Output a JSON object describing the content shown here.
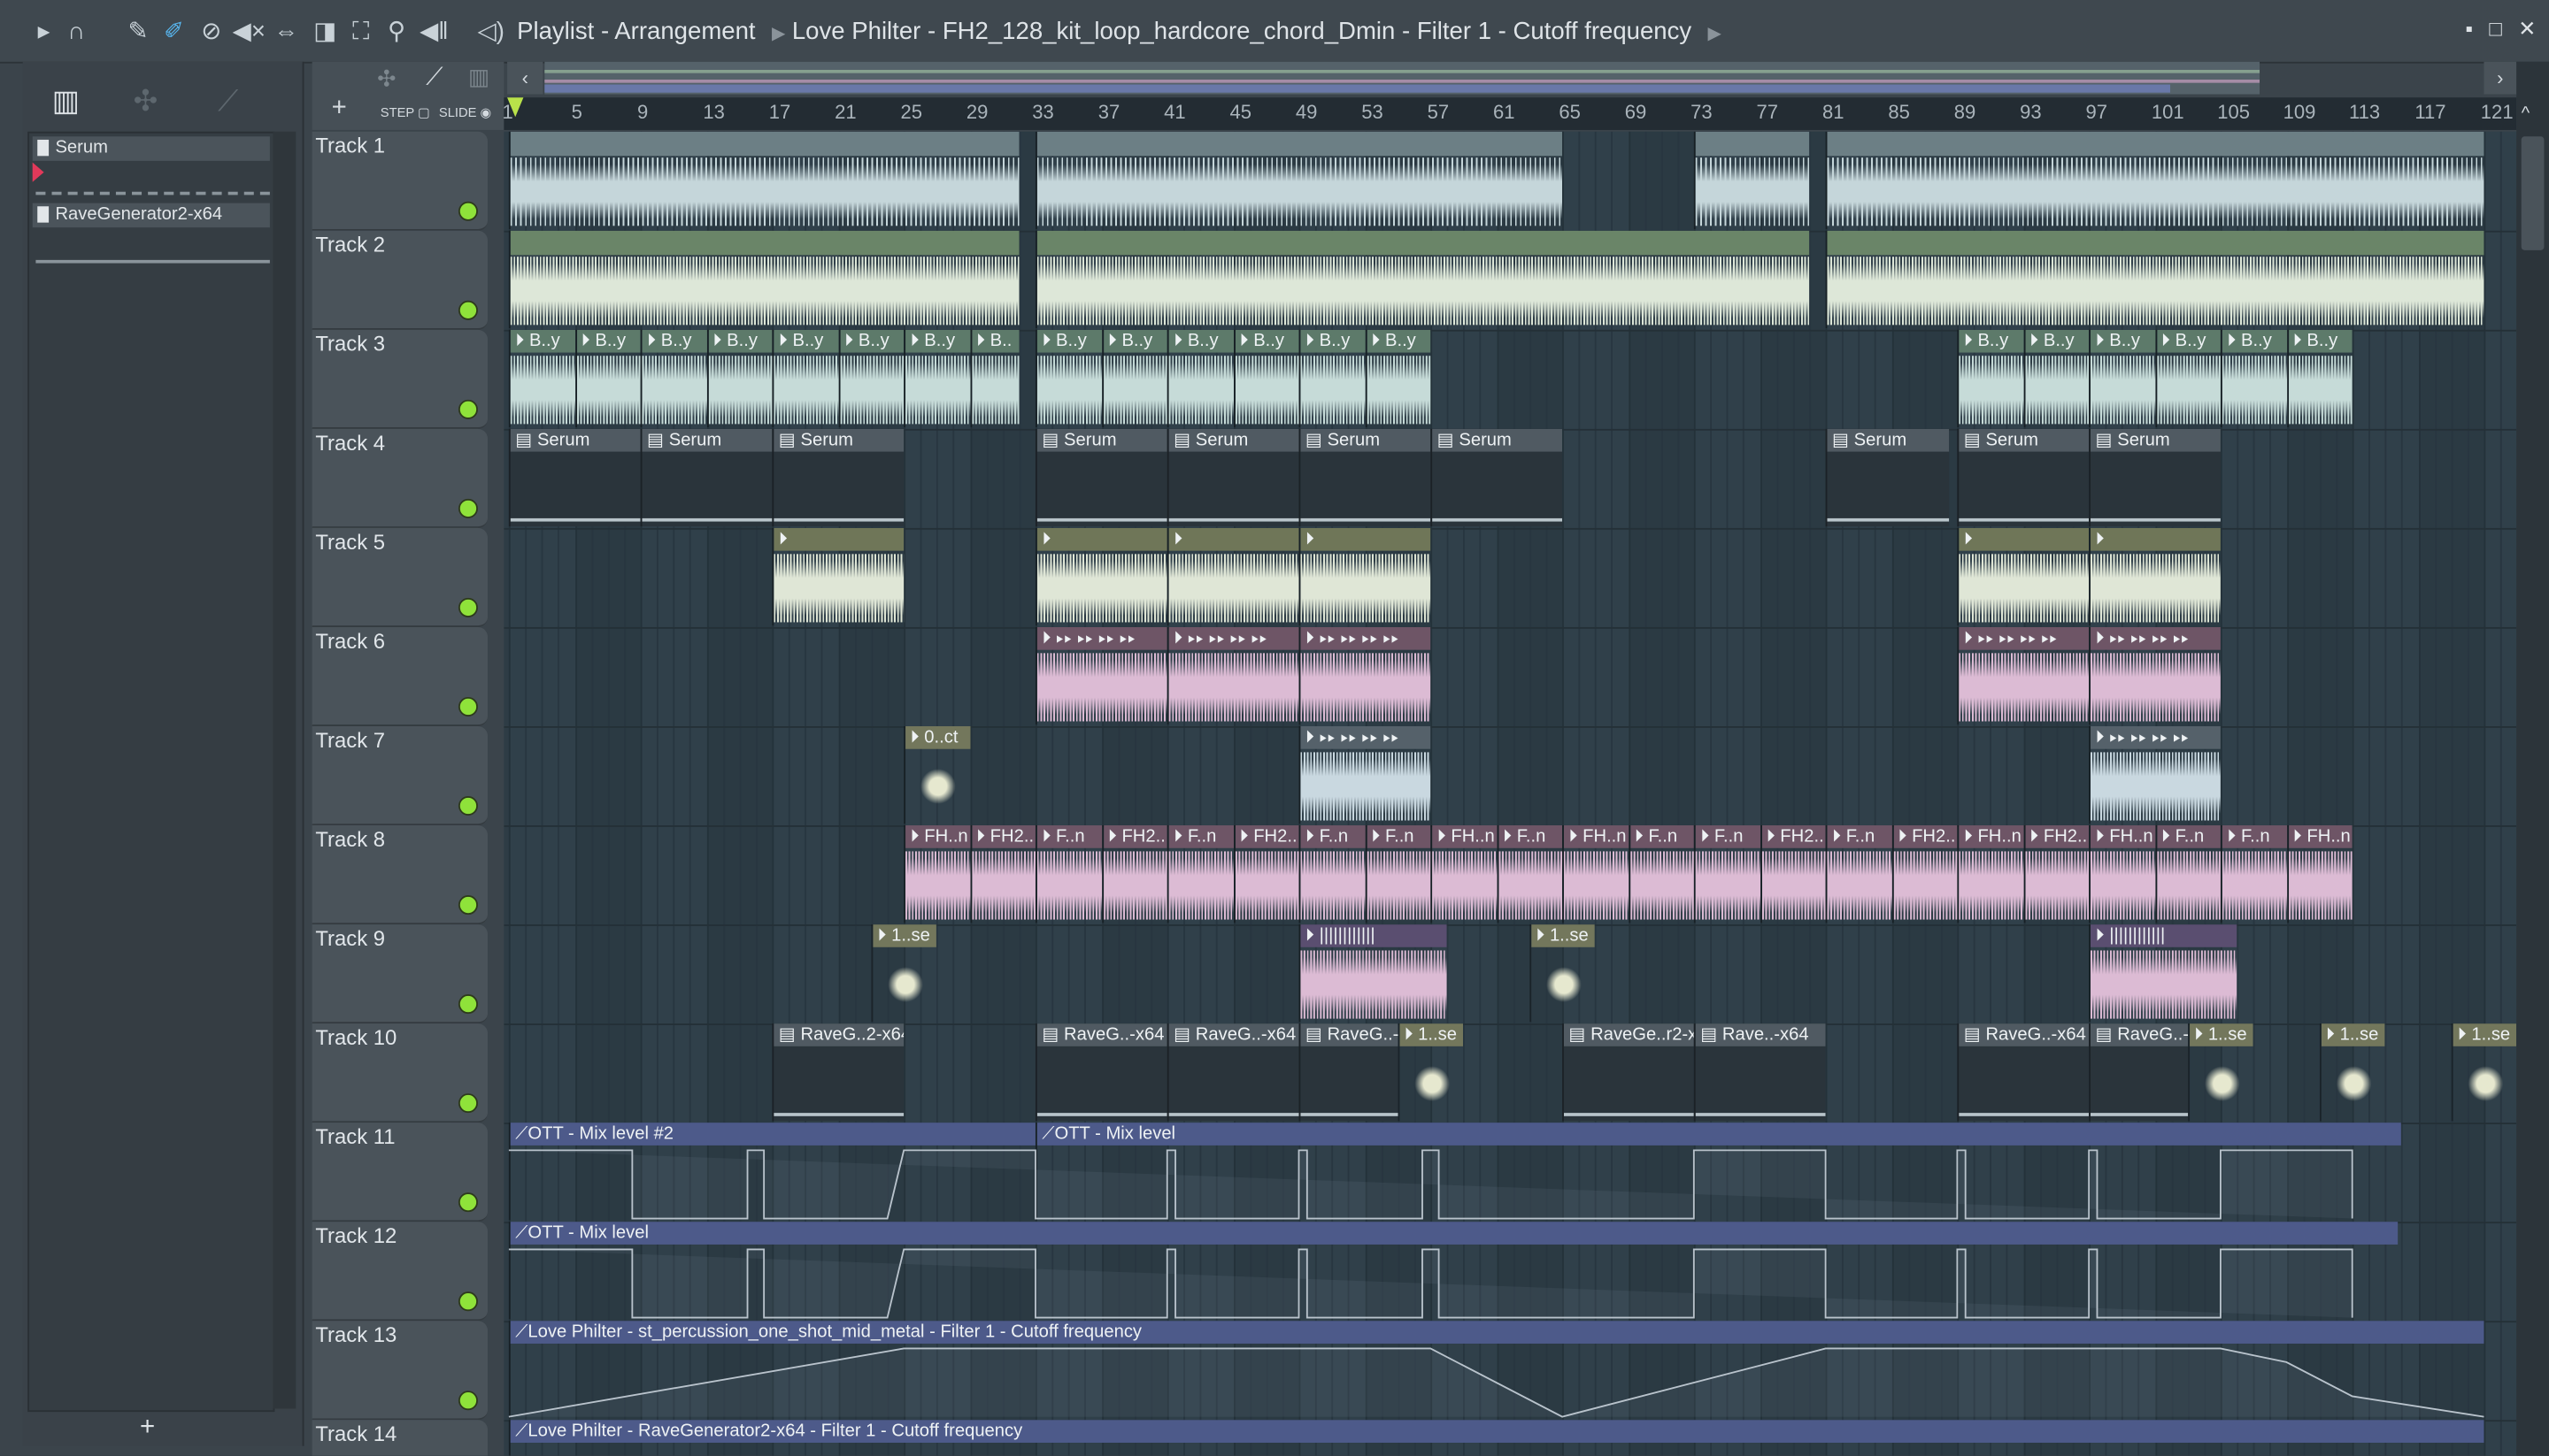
{
  "toolbar": {
    "icons": [
      "play-arrow-icon",
      "magnet-icon",
      "pencil-icon",
      "paint-icon",
      "delete-icon",
      "mute-icon",
      "slip-icon",
      "slice-icon",
      "select-icon",
      "zoom-icon",
      "playback-icon",
      "speaker-icon"
    ]
  },
  "breadcrumb": [
    "Playlist - Arrangement",
    "Love Philter - FH2_128_kit_loop_hardcore_chord_Dmin - Filter 1 - Cutoff frequency"
  ],
  "window_buttons": [
    "▪",
    "□",
    "✕"
  ],
  "browser": {
    "channels": [
      "Serum",
      "RaveGenerator2-x64"
    ],
    "add": "+"
  },
  "header_tools": {
    "add": "+",
    "step": "STEP",
    "slide": "SLIDE"
  },
  "ruler": [
    1,
    5,
    9,
    13,
    17,
    21,
    25,
    29,
    33,
    37,
    41,
    45,
    49,
    53,
    57,
    61,
    65,
    69,
    73,
    77,
    81,
    85,
    89,
    93,
    97,
    101,
    105,
    109,
    113,
    117,
    121
  ],
  "colors": {
    "audio": "#5d7a6a",
    "audio_wave": "#c6dbd8",
    "pattern": "#505a62",
    "olive": "#6f7658",
    "pink": "#6e5566",
    "pink_wave": "#dcbbd4",
    "purple": "#5a4e70",
    "cream": "#73775c",
    "auto": "#4d5a8a",
    "led": "#8fe23a"
  },
  "tracks": [
    {
      "name": "Track 1",
      "clips": [
        {
          "start": 1,
          "len": 31,
          "label": "",
          "type": "audio1"
        },
        {
          "start": 33,
          "len": 32,
          "label": "",
          "type": "audio1"
        },
        {
          "start": 73,
          "len": 7,
          "label": "",
          "type": "audio1"
        },
        {
          "start": 81,
          "len": 40,
          "label": "",
          "type": "audio1"
        }
      ]
    },
    {
      "name": "Track 2",
      "clips": [
        {
          "start": 1,
          "len": 31,
          "label": "",
          "type": "audio2"
        },
        {
          "start": 33,
          "len": 47,
          "label": "",
          "type": "audio2"
        },
        {
          "start": 81,
          "len": 40,
          "label": "",
          "type": "audio2"
        }
      ]
    },
    {
      "name": "Track 3",
      "clips": [
        {
          "start": 1,
          "len": 4,
          "label": "B..y",
          "type": "audio"
        },
        {
          "start": 5,
          "len": 4,
          "label": "B..y",
          "type": "audio"
        },
        {
          "start": 9,
          "len": 4,
          "label": "B..y",
          "type": "audio"
        },
        {
          "start": 13,
          "len": 4,
          "label": "B..y",
          "type": "audio"
        },
        {
          "start": 17,
          "len": 4,
          "label": "B..y",
          "type": "audio"
        },
        {
          "start": 21,
          "len": 4,
          "label": "B..y",
          "type": "audio"
        },
        {
          "start": 25,
          "len": 4,
          "label": "B..y",
          "type": "audio"
        },
        {
          "start": 29,
          "len": 3,
          "label": "B..",
          "type": "audio"
        },
        {
          "start": 33,
          "len": 4,
          "label": "B..y",
          "type": "audio"
        },
        {
          "start": 37,
          "len": 4,
          "label": "B..y",
          "type": "audio"
        },
        {
          "start": 41,
          "len": 4,
          "label": "B..y",
          "type": "audio"
        },
        {
          "start": 45,
          "len": 4,
          "label": "B..y",
          "type": "audio"
        },
        {
          "start": 49,
          "len": 4,
          "label": "B..y",
          "type": "audio"
        },
        {
          "start": 53,
          "len": 4,
          "label": "B..y",
          "type": "audio"
        },
        {
          "start": 89,
          "len": 4,
          "label": "B..y",
          "type": "audio"
        },
        {
          "start": 93,
          "len": 4,
          "label": "B..y",
          "type": "audio"
        },
        {
          "start": 97,
          "len": 4,
          "label": "B..y",
          "type": "audio"
        },
        {
          "start": 101,
          "len": 4,
          "label": "B..y",
          "type": "audio"
        },
        {
          "start": 105,
          "len": 4,
          "label": "B..y",
          "type": "audio"
        },
        {
          "start": 109,
          "len": 4,
          "label": "B..y",
          "type": "audio"
        }
      ]
    },
    {
      "name": "Track 4",
      "clips": [
        {
          "start": 1,
          "len": 8,
          "label": "Serum",
          "type": "pattern"
        },
        {
          "start": 9,
          "len": 8,
          "label": "Serum",
          "type": "pattern"
        },
        {
          "start": 17,
          "len": 8,
          "label": "Serum",
          "type": "pattern"
        },
        {
          "start": 33,
          "len": 8,
          "label": "Serum",
          "type": "pattern"
        },
        {
          "start": 41,
          "len": 8,
          "label": "Serum",
          "type": "pattern"
        },
        {
          "start": 49,
          "len": 8,
          "label": "Serum",
          "type": "pattern"
        },
        {
          "start": 57,
          "len": 8,
          "label": "Serum",
          "type": "pattern"
        },
        {
          "start": 81,
          "len": 7.5,
          "label": "Serum",
          "type": "pattern"
        },
        {
          "start": 89,
          "len": 8,
          "label": "Serum",
          "type": "pattern"
        },
        {
          "start": 97,
          "len": 8,
          "label": "Serum",
          "type": "pattern"
        }
      ]
    },
    {
      "name": "Track 5",
      "clips": [
        {
          "start": 17,
          "len": 8,
          "label": "",
          "type": "olive"
        },
        {
          "start": 33,
          "len": 8,
          "label": "",
          "type": "olive"
        },
        {
          "start": 41,
          "len": 8,
          "label": "",
          "type": "olive"
        },
        {
          "start": 49,
          "len": 8,
          "label": "",
          "type": "olive"
        },
        {
          "start": 89,
          "len": 8,
          "label": "",
          "type": "olive"
        },
        {
          "start": 97,
          "len": 8,
          "label": "",
          "type": "olive"
        }
      ]
    },
    {
      "name": "Track 6",
      "clips": [
        {
          "start": 33,
          "len": 8,
          "label": "▸▸ ▸▸ ▸▸ ▸▸",
          "type": "pink"
        },
        {
          "start": 41,
          "len": 8,
          "label": "▸▸ ▸▸ ▸▸ ▸▸",
          "type": "pink"
        },
        {
          "start": 49,
          "len": 8,
          "label": "▸▸ ▸▸ ▸▸ ▸▸",
          "type": "pink"
        },
        {
          "start": 89,
          "len": 8,
          "label": "▸▸ ▸▸ ▸▸ ▸▸",
          "type": "pink"
        },
        {
          "start": 97,
          "len": 8,
          "label": "▸▸ ▸▸ ▸▸ ▸▸",
          "type": "pink"
        }
      ]
    },
    {
      "name": "Track 7",
      "clips": [
        {
          "start": 25,
          "len": 4,
          "label": "0..ct",
          "type": "cream"
        },
        {
          "start": 49,
          "len": 8,
          "label": "▸▸ ▸▸ ▸▸ ▸▸",
          "type": "grey"
        },
        {
          "start": 97,
          "len": 8,
          "label": "▸▸ ▸▸ ▸▸ ▸▸",
          "type": "grey"
        }
      ]
    },
    {
      "name": "Track 8",
      "labels": [
        "FH..n",
        "FH2..",
        "F..n",
        "FH2..",
        "F..n",
        "FH2..",
        "F..n",
        "F..n",
        "FH..n",
        "F..n",
        "FH..n",
        "F..n",
        "F..n",
        "FH2..",
        "F..n",
        "FH2..",
        "FH..n",
        "FH2..",
        "FH..n",
        "F..n",
        "F..n",
        "FH..n"
      ],
      "clips": []
    },
    {
      "name": "Track 9",
      "clips": [
        {
          "start": 23,
          "len": 4,
          "label": "1..se",
          "type": "cream"
        },
        {
          "start": 49,
          "len": 9,
          "label": "||||||||||||",
          "type": "purple"
        },
        {
          "start": 63,
          "len": 4,
          "label": "1..se",
          "type": "cream"
        },
        {
          "start": 97,
          "len": 9,
          "label": "||||||||||||",
          "type": "purple"
        }
      ]
    },
    {
      "name": "Track 10",
      "clips": [
        {
          "start": 17,
          "len": 8,
          "label": "RaveG..2-x64",
          "type": "pattern"
        },
        {
          "start": 33,
          "len": 8,
          "label": "RaveG..-x64",
          "type": "pattern"
        },
        {
          "start": 41,
          "len": 8,
          "label": "RaveG..-x64",
          "type": "pattern"
        },
        {
          "start": 49,
          "len": 6,
          "label": "RaveG..->",
          "type": "pattern"
        },
        {
          "start": 55,
          "len": 4,
          "label": "1..se",
          "type": "cream"
        },
        {
          "start": 65,
          "len": 8,
          "label": "RaveGe..r2-x",
          "type": "pattern"
        },
        {
          "start": 73,
          "len": 8,
          "label": "Rave..-x64",
          "type": "pattern"
        },
        {
          "start": 89,
          "len": 8,
          "label": "RaveG..-x64",
          "type": "pattern"
        },
        {
          "start": 97,
          "len": 6,
          "label": "RaveG..->",
          "type": "pattern"
        },
        {
          "start": 103,
          "len": 4,
          "label": "1..se",
          "type": "cream"
        },
        {
          "start": 111,
          "len": 4,
          "label": "1..se",
          "type": "cream"
        },
        {
          "start": 119,
          "len": 4,
          "label": "1..se",
          "type": "cream"
        }
      ]
    },
    {
      "name": "Track 11",
      "clips": [
        {
          "start": 1,
          "len": 32,
          "label": "OTT - Mix level #2",
          "type": "auto"
        },
        {
          "start": 33,
          "len": 83,
          "label": "OTT - Mix level",
          "type": "auto"
        }
      ]
    },
    {
      "name": "Track 12",
      "clips": [
        {
          "start": 1,
          "len": 114.8,
          "label": "OTT - Mix level",
          "type": "auto"
        }
      ]
    },
    {
      "name": "Track 13",
      "clips": [
        {
          "start": 1,
          "len": 120,
          "label": "Love Philter - st_percussion_one_shot_mid_metal - Filter 1 - Cutoff frequency",
          "type": "auto"
        }
      ]
    },
    {
      "name": "Track 14",
      "clips": [
        {
          "start": 1,
          "len": 120,
          "label": "Love Philter - RaveGenerator2-x64 - Filter 1 - Cutoff frequency",
          "type": "auto"
        }
      ]
    }
  ]
}
